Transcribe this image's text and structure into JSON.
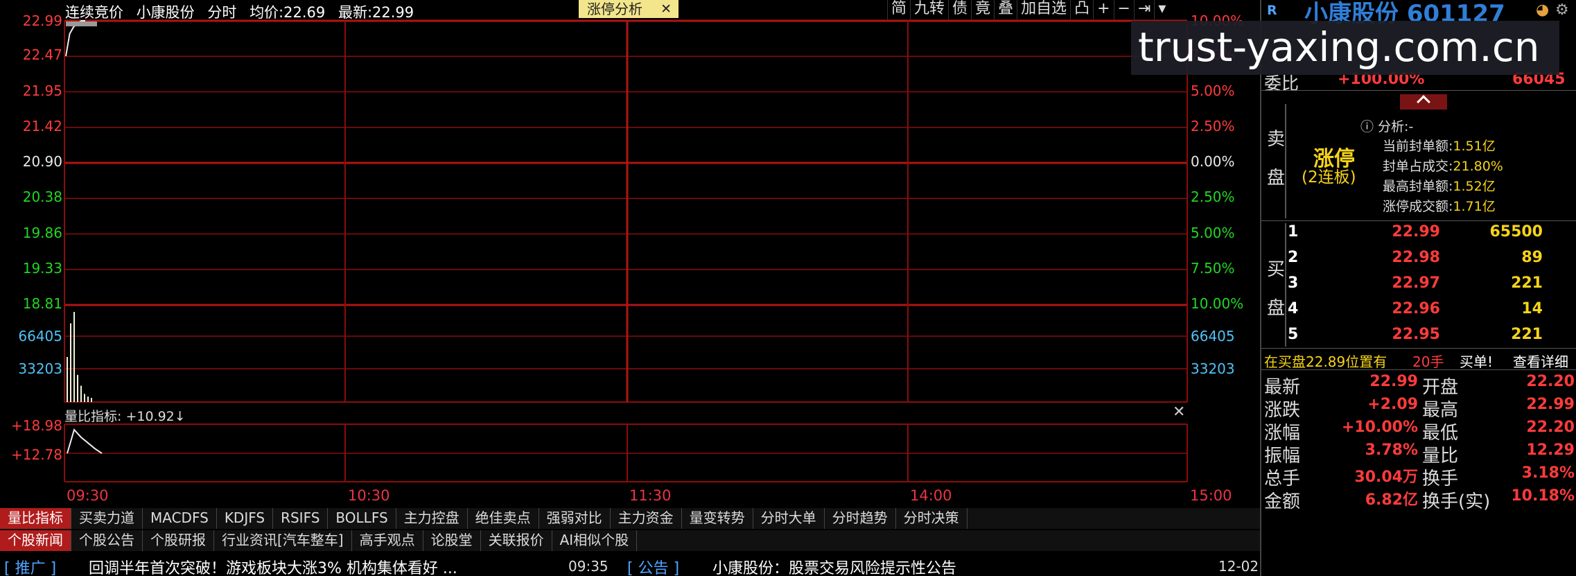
{
  "header": {
    "auction": "连续竞价",
    "stock": "小康股份",
    "mode": "分时",
    "avg_label": "均价:",
    "avg_value": "22.69",
    "latest_label": "最新:",
    "latest_value": "22.99"
  },
  "limit_tab": {
    "label": "涨停分析",
    "close": "✕"
  },
  "tools": [
    "简",
    "九转",
    "债",
    "竟",
    "叠",
    "加自选",
    "凸",
    "+",
    "−",
    "⇥",
    "▾"
  ],
  "price_axis": {
    "left": [
      "22.99",
      "22.47",
      "21.95",
      "21.42",
      "20.90",
      "20.38",
      "19.86",
      "19.33",
      "18.81"
    ],
    "right": [
      "10.00%",
      "7.50%",
      "5.00%",
      "2.50%",
      "0.00%",
      "2.50%",
      "5.00%",
      "7.50%",
      "10.00%"
    ]
  },
  "volume_axis": {
    "left": [
      "66405",
      "33203"
    ],
    "right": [
      "66405",
      "33203"
    ]
  },
  "volume_ratio": {
    "title": "量比指标: +10.92↓",
    "ticks": [
      "+18.98",
      "+12.78"
    ],
    "close": "✕"
  },
  "time_axis": [
    "09:30",
    "10:30",
    "11:30",
    "14:00",
    "15:00"
  ],
  "chart_data": {
    "type": "line",
    "x": [
      "09:30",
      "09:31",
      "09:32",
      "09:33",
      "09:34",
      "09:35"
    ],
    "series": [
      {
        "values": [
          22.47,
          22.8,
          22.9,
          22.95,
          22.99,
          22.99
        ]
      }
    ],
    "volume": [
      33203,
      58000,
      66405,
      20000,
      12000,
      6000,
      4000,
      3000
    ],
    "volume_ratio": [
      12.78,
      18.98,
      17.0,
      15.5,
      14.0,
      12.78
    ],
    "ylim": [
      18.81,
      22.99
    ],
    "yclose": 20.9
  },
  "bottom_tabs": {
    "row1": [
      "量比指标",
      "买卖力道",
      "MACDFS",
      "KDJFS",
      "RSIFS",
      "BOLLFS",
      "主力控盘",
      "绝佳卖点",
      "强弱对比",
      "主力资金",
      "量变转势",
      "分时大单",
      "分时趋势",
      "分时决策"
    ],
    "row2": [
      "个股新闻",
      "个股公告",
      "个股研报",
      "行业资讯[汽车整车]",
      "高手观点",
      "论股堂",
      "关联报价",
      "AI相似个股"
    ]
  },
  "news": {
    "tag": "[ 推广 ]",
    "headline": "回调半年首次突破！游戏板块大涨3% 机构集体看好 ...",
    "time": "09:35",
    "notice_tag": "[ 公告 ]",
    "notice": "小康股份：股票交易风险提示性公告",
    "date": "12-02"
  },
  "right_panel": {
    "badge": "R",
    "stock_title": "小康股份 601127",
    "watermark": "trust-yaxing.com.cn",
    "webi_label": "委比",
    "webi_value": "+100.00%",
    "webi_diff": "66045",
    "sell_label": [
      "卖",
      "盘"
    ],
    "buy_label": [
      "买",
      "盘"
    ],
    "limit_up": "涨停",
    "limit_up_sub": "(2连板)",
    "analysis_title": "分析:-",
    "analysis": [
      {
        "label": "当前封单额:",
        "value": "1.51亿"
      },
      {
        "label": "封单占成交:",
        "value": "21.80%"
      },
      {
        "label": "最高封单额:",
        "value": "1.52亿"
      },
      {
        "label": "涨停成交额:",
        "value": "1.71亿"
      }
    ],
    "bids": [
      {
        "level": "1",
        "price": "22.99",
        "vol": "65500"
      },
      {
        "level": "2",
        "price": "22.98",
        "vol": "89"
      },
      {
        "level": "3",
        "price": "22.97",
        "vol": "221"
      },
      {
        "level": "4",
        "price": "22.96",
        "vol": "14"
      },
      {
        "level": "5",
        "price": "22.95",
        "vol": "221"
      }
    ],
    "queue": {
      "text": "在买盘22.89位置有",
      "hands": "20手",
      "action": "买单!",
      "detail": "查看详细"
    },
    "stats": [
      {
        "l1": "最新",
        "v1": "22.99",
        "l2": "开盘",
        "v2": "22.20"
      },
      {
        "l1": "涨跌",
        "v1": "+2.09",
        "l2": "最高",
        "v2": "22.99"
      },
      {
        "l1": "涨幅",
        "v1": "+10.00%",
        "l2": "最低",
        "v2": "22.20"
      },
      {
        "l1": "振幅",
        "v1": "3.78%",
        "l2": "量比",
        "v2": "12.29"
      },
      {
        "l1": "总手",
        "v1": "30.04万",
        "l2": "换手",
        "v2": "3.18%"
      },
      {
        "l1": "金额",
        "v1": "6.82亿",
        "l2": "换手(实)",
        "v2": "10.18%"
      }
    ]
  },
  "colors": {
    "up": "#ff3b3b",
    "down": "#22d622",
    "grid": "#8b0d0d",
    "accent": "#f6d419"
  }
}
